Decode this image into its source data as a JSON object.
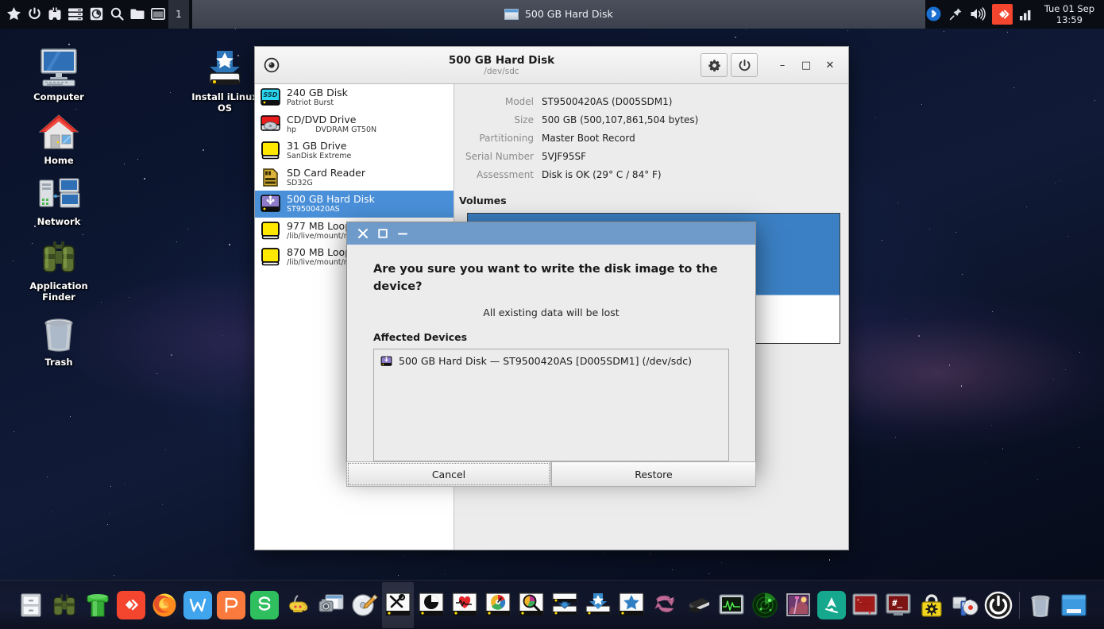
{
  "panel": {
    "left_icons": [
      {
        "name": "star-icon"
      },
      {
        "name": "power-icon"
      },
      {
        "name": "binoculars-icon"
      },
      {
        "name": "server-list-icon"
      },
      {
        "name": "disk-usage-icon"
      },
      {
        "name": "search-icon"
      },
      {
        "name": "folder-icon"
      },
      {
        "name": "window-icon"
      }
    ],
    "workspace": "1",
    "task": {
      "label": "500 GB Hard Disk",
      "icon": "window-mini-icon"
    },
    "tray": [
      {
        "name": "bluetooth-icon"
      },
      {
        "name": "pin-icon"
      },
      {
        "name": "volume-icon"
      },
      {
        "name": "anydesk-icon"
      },
      {
        "name": "signal-bars-icon"
      }
    ],
    "clock_date": "Tue 01 Sep",
    "clock_time": "13:59"
  },
  "desktop_icons": [
    {
      "label": "Computer",
      "icon": "computer-icon"
    },
    {
      "label": "Home",
      "icon": "home-icon"
    },
    {
      "label": "Network",
      "icon": "network-icon"
    },
    {
      "label": "Application\nFinder",
      "line1": "Application",
      "line2": "Finder",
      "icon": "binoculars-icon"
    },
    {
      "label": "Trash",
      "icon": "trash-icon"
    },
    {
      "label": "Install iLinux OS",
      "line1": "Install iLinux",
      "line2": "OS",
      "icon": "install-icon"
    }
  ],
  "disks_window": {
    "title": "500 GB Hard Disk",
    "subtitle": "/dev/sdc",
    "app_icon": "disk-app-icon",
    "header_buttons": [
      {
        "name": "settings-button",
        "icon": "gear-icon"
      },
      {
        "name": "power-button",
        "icon": "power-icon"
      }
    ],
    "window_controls": [
      {
        "name": "minimize-button",
        "glyph": "–"
      },
      {
        "name": "maximize-button",
        "glyph": "□"
      },
      {
        "name": "close-button",
        "glyph": "✕"
      }
    ],
    "devices": [
      {
        "name": "240 GB Disk",
        "sub": "Patriot Burst",
        "icon": "ssd-icon",
        "selected": false
      },
      {
        "name": "CD/DVD Drive",
        "sub": "hp        DVDRAM GT50N",
        "icon": "cdrom-icon",
        "selected": false
      },
      {
        "name": "31 GB Drive",
        "sub": "SanDisk Extreme",
        "icon": "usb-drive-icon",
        "selected": false
      },
      {
        "name": "SD Card Reader",
        "sub": "SD32G",
        "icon": "sdcard-icon",
        "selected": false
      },
      {
        "name": "500 GB Hard Disk",
        "sub": "ST9500420AS",
        "icon": "usb-hdd-icon",
        "selected": true
      },
      {
        "name": "977 MB Loop Device",
        "sub": "/lib/live/mount/medium/live/filesystem.squashfs",
        "icon": "loop-icon",
        "selected": false
      },
      {
        "name": "870 MB Loop Device",
        "sub": "/lib/live/mount/medium/live/filesystem.squashfs",
        "icon": "loop-icon",
        "selected": false
      }
    ],
    "info": [
      {
        "label": "Model",
        "value": "ST9500420AS (D005SDM1)"
      },
      {
        "label": "Size",
        "value": "500 GB (500,107,861,504 bytes)"
      },
      {
        "label": "Partitioning",
        "value": "Master Boot Record"
      },
      {
        "label": "Serial Number",
        "value": "5VJF95SF"
      },
      {
        "label": "Assessment",
        "value": "Disk is OK (29° C / 84° F)"
      }
    ],
    "volumes_heading": "Volumes"
  },
  "dialog": {
    "window_controls": [
      {
        "name": "close-button",
        "glyph": "✕"
      },
      {
        "name": "maximize-button",
        "glyph": "□"
      },
      {
        "name": "minimize-button",
        "glyph": "—"
      }
    ],
    "heading": "Are you sure you want to write the disk image to the device?",
    "subtext": "All existing data will be lost",
    "affected_label": "Affected Devices",
    "affected_devices": [
      {
        "text": "500 GB Hard Disk — ST9500420AS [D005SDM1] (/dev/sdc)",
        "icon": "usb-hdd-icon"
      }
    ],
    "cancel_label": "Cancel",
    "confirm_label": "Restore"
  },
  "dock": [
    {
      "name": "file-manager-icon"
    },
    {
      "name": "binoculars-icon"
    },
    {
      "name": "pipe-icon"
    },
    {
      "name": "anydesk-icon"
    },
    {
      "name": "firefox-icon"
    },
    {
      "name": "wps-writer-icon"
    },
    {
      "name": "wps-presentation-icon"
    },
    {
      "name": "wps-spreadsheet-icon"
    },
    {
      "name": "genie-lamp-icon"
    },
    {
      "name": "screenshot-icon"
    },
    {
      "name": "disc-burner-icon"
    },
    {
      "name": "tools-icon"
    },
    {
      "name": "partition-chart-icon"
    },
    {
      "name": "disk-health-icon"
    },
    {
      "name": "disk-gauge-icon"
    },
    {
      "name": "disk-analyzer-icon"
    },
    {
      "name": "disk-write-icon"
    },
    {
      "name": "disk-clone-icon"
    },
    {
      "name": "disk-install-icon"
    },
    {
      "name": "disk-star-icon"
    },
    {
      "name": "sync-icon"
    },
    {
      "name": "archive-icon"
    },
    {
      "name": "system-monitor-icon"
    },
    {
      "name": "radar-icon"
    },
    {
      "name": "gimp-icon"
    },
    {
      "name": "inkscape-icon"
    },
    {
      "name": "terminal-red-icon"
    },
    {
      "name": "terminal-root-icon"
    },
    {
      "name": "password-lock-icon"
    },
    {
      "name": "media-devices-icon"
    },
    {
      "name": "shutdown-icon"
    },
    {
      "name": "trash-icon"
    },
    {
      "name": "show-desktop-icon"
    }
  ],
  "colors": {
    "selection_blue": "#4a90d9",
    "dialog_title_blue": "#6f9bcb",
    "volume_blue": "#3b80c4",
    "accent_red": "#f4452e",
    "panel_dark": "#0b0d14"
  }
}
